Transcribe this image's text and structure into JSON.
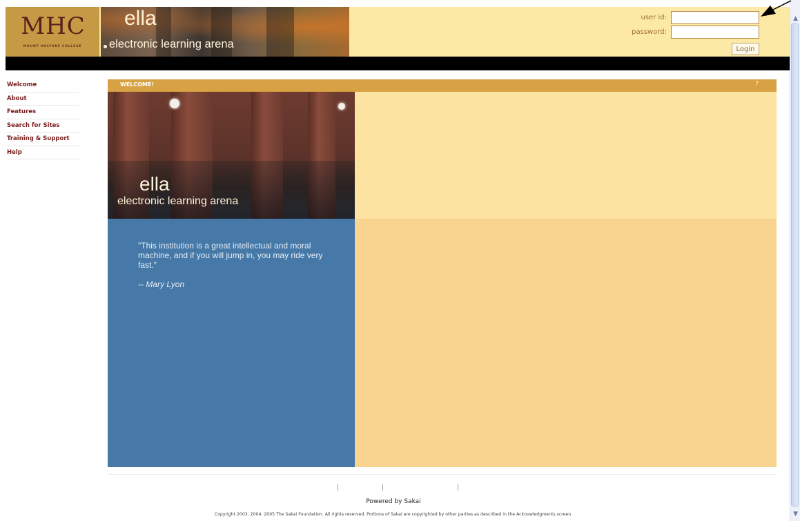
{
  "logo": {
    "mark": "MHC",
    "sub": "MOUNT HOLYOKE COLLEGE"
  },
  "banner": {
    "title": "ella",
    "subtitle": "electronic learning arena"
  },
  "login": {
    "user_label": "user id:",
    "pass_label": "password:",
    "button_label": "Login",
    "user_value": "",
    "pass_value": ""
  },
  "nav": {
    "items": [
      "Welcome",
      "About",
      "Features",
      "Search for Sites",
      "Training & Support",
      "Help"
    ]
  },
  "welcome": {
    "title": "WELCOME!",
    "help": "?"
  },
  "photo": {
    "title": "ella",
    "subtitle": "electronic learning arena"
  },
  "quote": {
    "text": "\"This institution is a great intellectual and moral machine, and if you will jump in, you may ride very fast.\"",
    "author": "-- Mary Lyon"
  },
  "footer": {
    "separators": [
      "|",
      "|",
      "|"
    ],
    "powered": "Powered by Sakai",
    "copyright": "Copyright 2003, 2004, 2005 The Sakai Foundation. All rights reserved. Portions of Sakai are copyrighted by other parties as described in the Acknowledgments screen."
  },
  "colors": {
    "header_bg": "#fde9a6",
    "welcome_bar": "#d8a244",
    "quote_bg": "#4679a8",
    "content_bg": "#f8d490",
    "nav_text": "#7a1c1c"
  }
}
